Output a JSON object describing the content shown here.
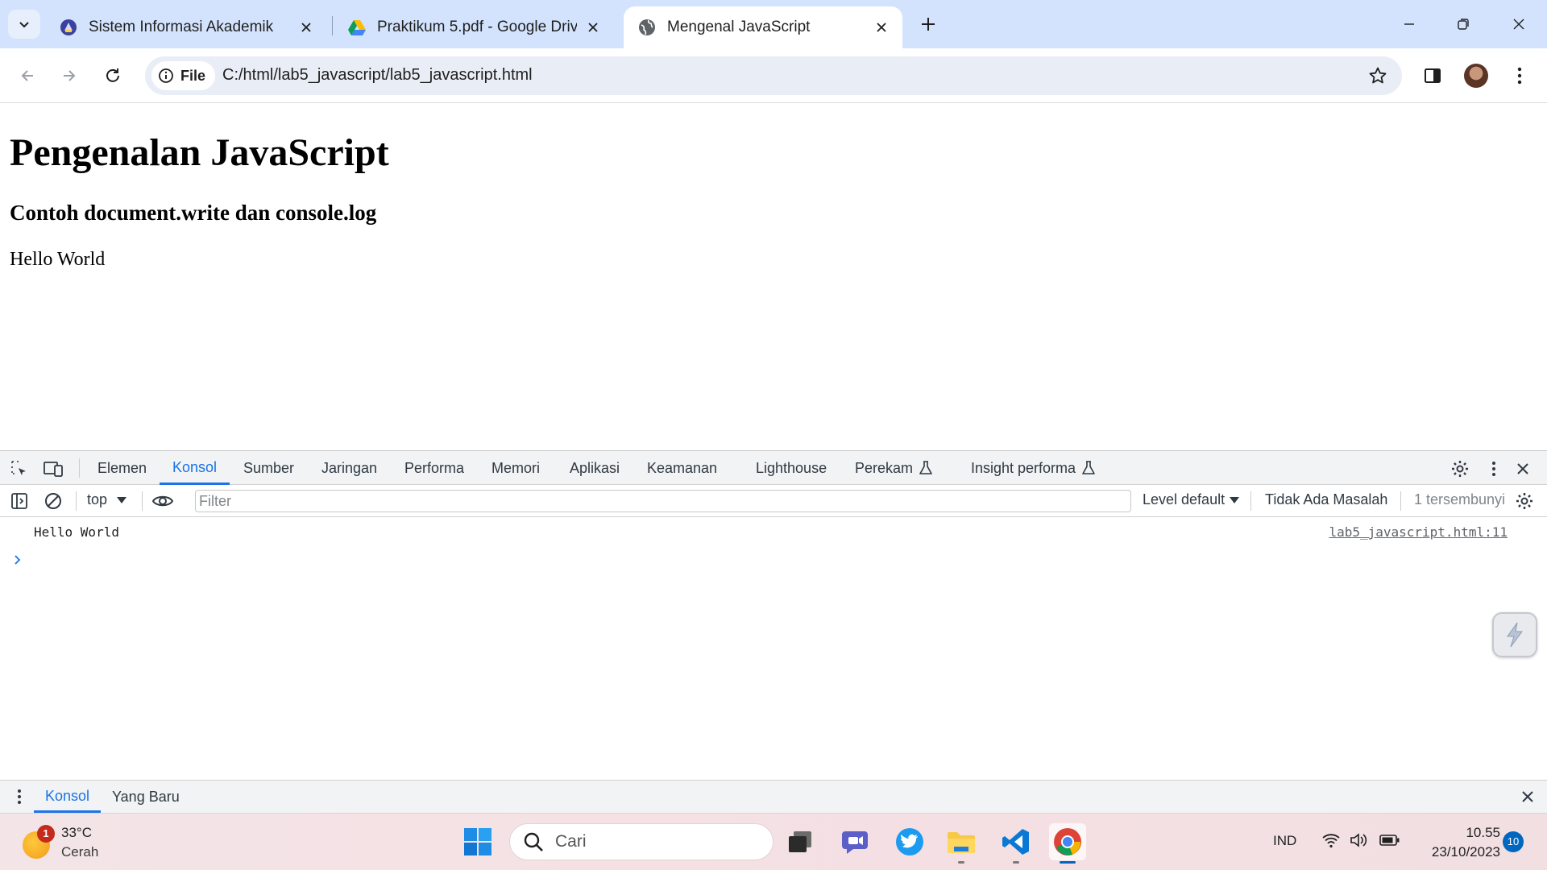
{
  "browser": {
    "tabs": [
      {
        "title": "Sistem Informasi Akademik"
      },
      {
        "title": "Praktikum 5.pdf - Google Drive"
      },
      {
        "title": "Mengenal JavaScript"
      }
    ],
    "omnibox": {
      "scheme_chip": "File",
      "url": "C:/html/lab5_javascript/lab5_javascript.html"
    }
  },
  "page": {
    "heading": "Pengenalan JavaScript",
    "subheading": "Contoh document.write dan console.log",
    "paragraph": "Hello World"
  },
  "devtools": {
    "tabs": [
      "Elemen",
      "Konsol",
      "Sumber",
      "Jaringan",
      "Performa",
      "Memori",
      "Aplikasi",
      "Keamanan",
      "Lighthouse",
      "Perekam",
      "Insight performa"
    ],
    "active_tab": "Konsol",
    "context": "top",
    "filter_placeholder": "Filter",
    "level": "Level default",
    "issues": "Tidak Ada Masalah",
    "hidden": "1 tersembunyi",
    "console": {
      "message": "Hello World",
      "source": "lab5_javascript.html:11"
    },
    "drawer_tabs": [
      "Konsol",
      "Yang Baru"
    ]
  },
  "taskbar": {
    "weather_temp": "33°C",
    "weather_condition": "Cerah",
    "weather_badge": "1",
    "search_placeholder": "Cari",
    "language": "IND",
    "time": "10.55",
    "date": "23/10/2023",
    "notifications": "10"
  },
  "colors": {
    "tabstrip": "#d3e3fd",
    "accent": "#1a73e8",
    "taskbar": "#f3e4e7"
  }
}
